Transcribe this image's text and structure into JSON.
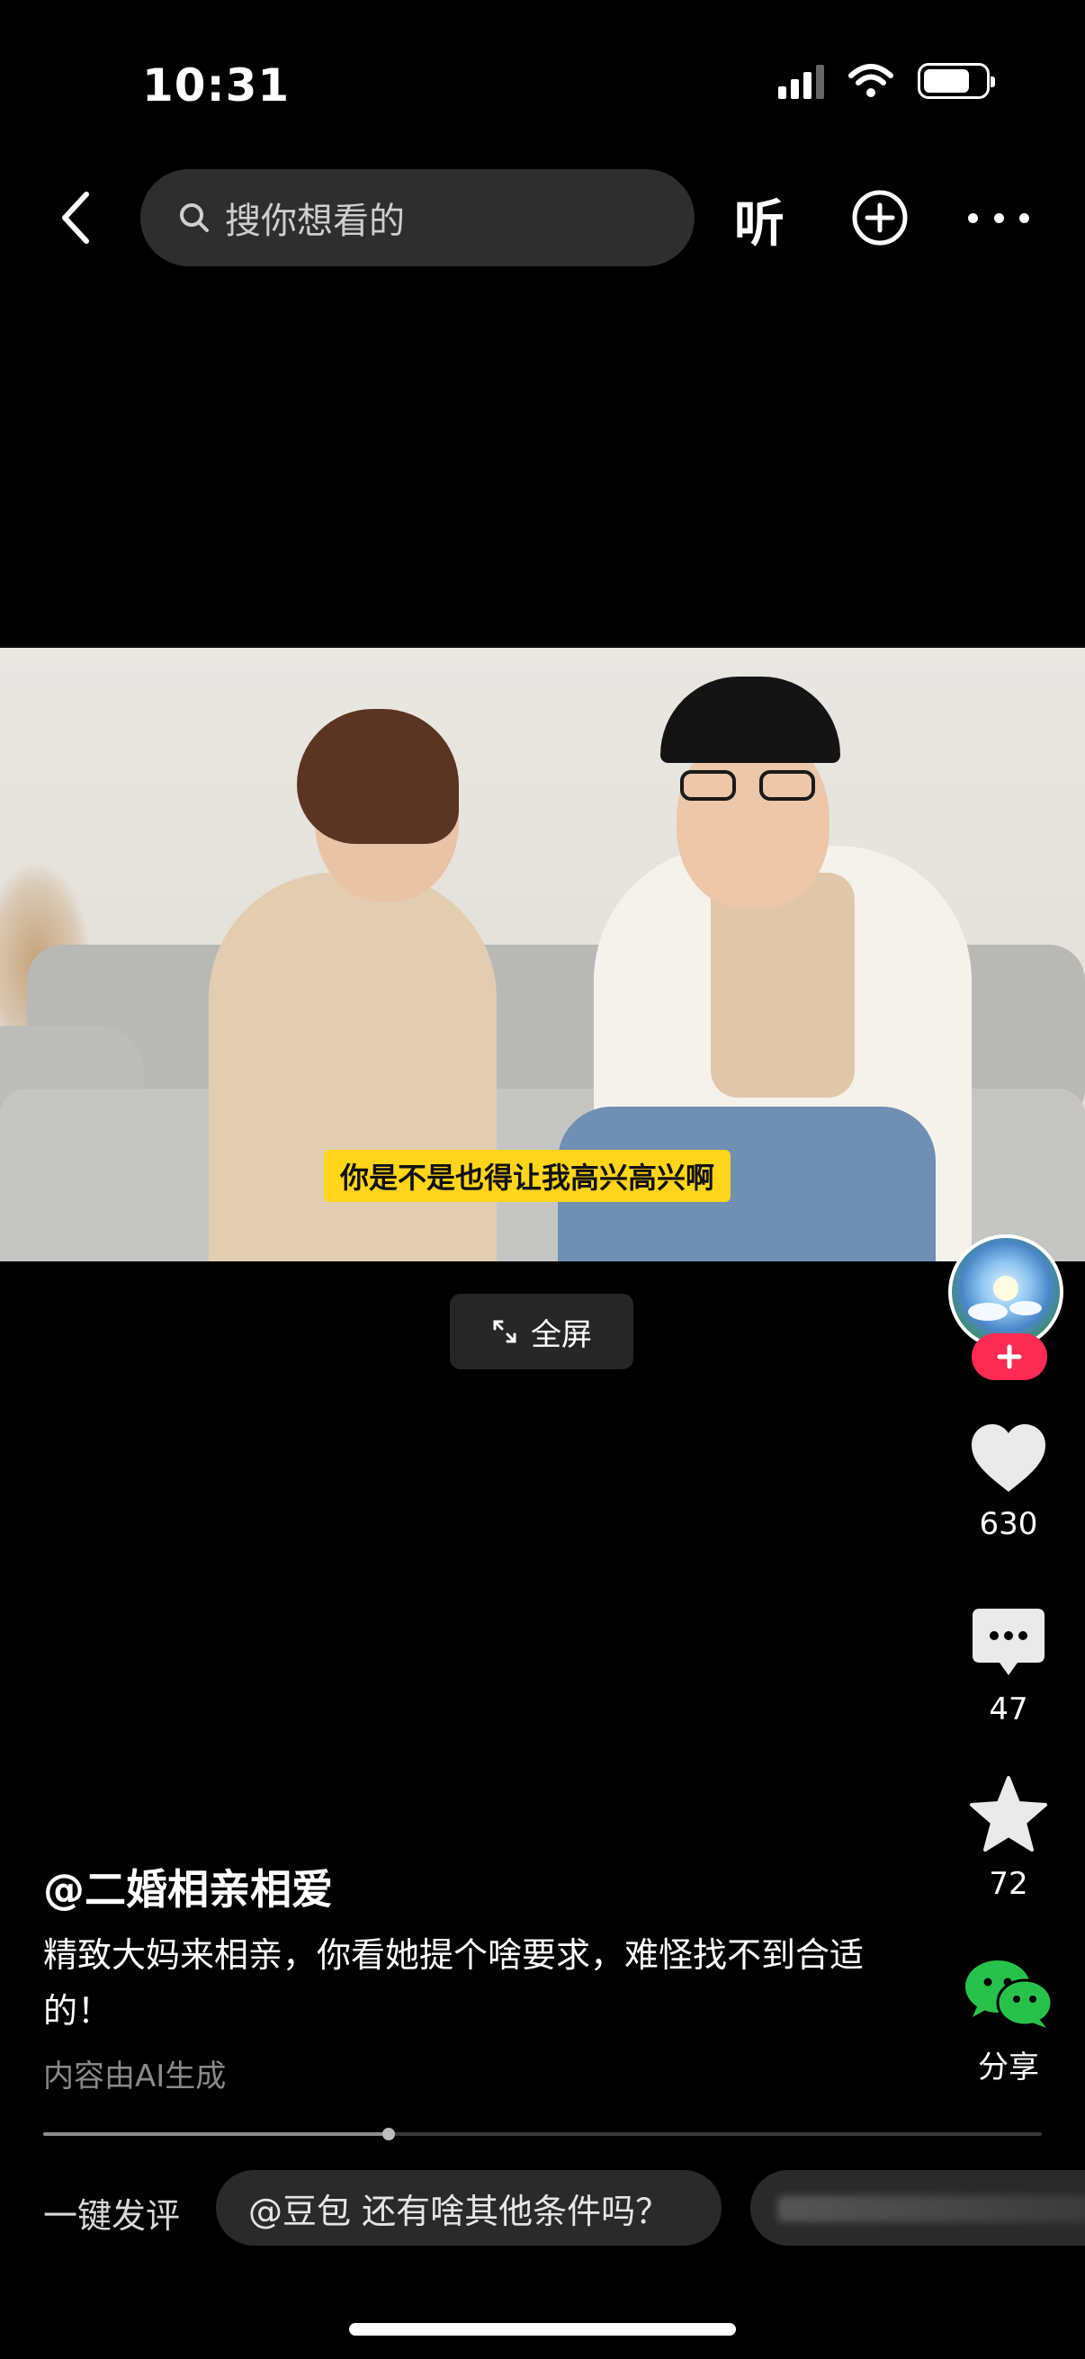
{
  "status_bar": {
    "time": "10:31",
    "battery_level": 0.75
  },
  "nav": {
    "search_placeholder": "搜你想看的",
    "listen_label": "听"
  },
  "video": {
    "subtitle": "你是不是也得让我高兴高兴啊",
    "fullscreen_label": "全屏"
  },
  "actions": {
    "likes": "630",
    "comments": "47",
    "favorites": "72",
    "share_label": "分享",
    "colors": {
      "follow": "#fe2c55",
      "wechat": "#27c24c"
    }
  },
  "post": {
    "author": "@二婚相亲相爱",
    "description": "精致大妈来相亲，你看她提个啥要求，难怪找不到合适的！",
    "ai_note": "内容由AI生成",
    "progress": 0.346
  },
  "quick_comment": {
    "label": "一键发评",
    "chips": [
      "@豆包 还有啥其他条件吗？"
    ]
  }
}
